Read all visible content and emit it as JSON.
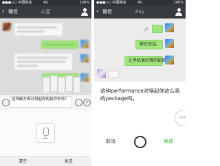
{
  "left_phone": {
    "status": {
      "carrier": "●●●○○ 中国移动",
      "center": "4G",
      "battery": "100%"
    },
    "nav": {
      "back_label": "微信",
      "title": "火星"
    },
    "input_text": "这种破方面对得起你的拍拜车吗？",
    "actions": {
      "clear": "清空",
      "send": "发送"
    }
  },
  "right_phone": {
    "status": {
      "carrier": "●●●○○ 中国移动",
      "center": "4G",
      "battery": "100%"
    },
    "nav": {
      "back_label": "微信",
      "title": "Ray"
    },
    "messages": [
      {
        "side": "right",
        "text": "3\""
      },
      {
        "side": "right",
        "text": "按住说话。"
      },
      {
        "side": "right",
        "text": "让手机更好用的秘密。"
      }
    ],
    "recognized_text_line1": "这种performance对得起你这么高",
    "recognized_text_line2": "的package吗。",
    "badge": "ARN",
    "actions": {
      "cancel": "取消",
      "send": "发送"
    }
  },
  "colors": {
    "nav_bg": "#383c41",
    "send_green": "#1aad19",
    "bubble_green": "#a1e57c"
  }
}
